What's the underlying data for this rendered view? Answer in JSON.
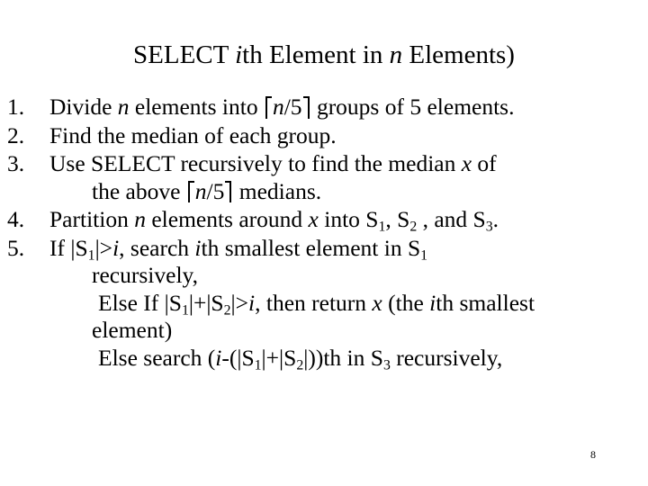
{
  "slide": {
    "background_color": "#ffffff",
    "text_color": "#000000",
    "page_number": "8",
    "title": {
      "full_text": "SELECT ith Element in n Elements)",
      "part1": "SELECT ",
      "var_i": "i",
      "part2": "th Element in ",
      "var_n": "n",
      "part3": " Elements)"
    },
    "steps": [
      {
        "marker": "1.",
        "full_text": "Divide n elements into ⌈n/5⌉ groups of 5 elements.",
        "lines": [
          {
            "segments": [
              {
                "t": "Divide ",
                "style": "roman"
              },
              {
                "t": "n",
                "style": "italic"
              },
              {
                "t": " elements into ",
                "style": "roman"
              },
              {
                "t": "⌈",
                "style": "ceil-open"
              },
              {
                "t": "n",
                "style": "italic"
              },
              {
                "t": "/5",
                "style": "roman"
              },
              {
                "t": "⌉",
                "style": "ceil-close"
              },
              {
                "t": " groups of 5 elements.",
                "style": "roman"
              }
            ]
          }
        ]
      },
      {
        "marker": "2.",
        "full_text": "Find the median of each group.",
        "lines": [
          {
            "segments": [
              {
                "t": "Find the median of each group.",
                "style": "roman"
              }
            ]
          }
        ]
      },
      {
        "marker": "3.",
        "full_text": "Use SELECT recursively to find the median x of the above ⌈n/5⌉ medians.",
        "lines": [
          {
            "segments": [
              {
                "t": "Use SELECT recursively to find the median ",
                "style": "roman"
              },
              {
                "t": "x",
                "style": "italic"
              },
              {
                "t": " of",
                "style": "roman"
              }
            ]
          },
          {
            "segments": [
              {
                "t": "the above ",
                "style": "roman"
              },
              {
                "t": "⌈",
                "style": "ceil-open"
              },
              {
                "t": "n",
                "style": "italic"
              },
              {
                "t": "/5",
                "style": "roman"
              },
              {
                "t": "⌉",
                "style": "ceil-close"
              },
              {
                "t": " medians.",
                "style": "roman"
              }
            ]
          }
        ]
      },
      {
        "marker": "4.",
        "full_text": "Partition n elements around x into S1, S2 , and S3.",
        "lines": [
          {
            "segments": [
              {
                "t": "Partition ",
                "style": "roman"
              },
              {
                "t": "n",
                "style": "italic"
              },
              {
                "t": " elements around ",
                "style": "roman"
              },
              {
                "t": "x",
                "style": "italic"
              },
              {
                "t": " into S",
                "style": "roman"
              },
              {
                "t": "1",
                "style": "sub"
              },
              {
                "t": ", S",
                "style": "roman"
              },
              {
                "t": "2",
                "style": "sub"
              },
              {
                "t": " , and S",
                "style": "roman"
              },
              {
                "t": "3",
                "style": "sub"
              },
              {
                "t": ".",
                "style": "roman"
              }
            ]
          }
        ]
      },
      {
        "marker": "5.",
        "full_text": "If |S1|>i, search ith smallest element in S1 recursively, Else If |S1|+|S2|>i, then return x (the ith smallest element) Else search (i-(|S1|+|S2|))th in S3 recursively,",
        "lines": [
          {
            "segments": [
              {
                "t": "If |S",
                "style": "roman"
              },
              {
                "t": "1",
                "style": "sub"
              },
              {
                "t": "|>",
                "style": "roman"
              },
              {
                "t": "i",
                "style": "italic"
              },
              {
                "t": ", search ",
                "style": "roman"
              },
              {
                "t": "i",
                "style": "italic"
              },
              {
                "t": "th smallest element in S",
                "style": "roman"
              },
              {
                "t": "1",
                "style": "sub"
              }
            ]
          },
          {
            "segments": [
              {
                "t": "recursively,",
                "style": "roman"
              }
            ]
          },
          {
            "indent": "else",
            "segments": [
              {
                "t": " Else If |S",
                "style": "roman"
              },
              {
                "t": "1",
                "style": "sub"
              },
              {
                "t": "|+|S",
                "style": "roman"
              },
              {
                "t": "2",
                "style": "sub"
              },
              {
                "t": "|>",
                "style": "roman"
              },
              {
                "t": "i",
                "style": "italic"
              },
              {
                "t": ", then return ",
                "style": "roman"
              },
              {
                "t": "x",
                "style": "italic"
              },
              {
                "t": " (the ",
                "style": "roman"
              },
              {
                "t": "i",
                "style": "italic"
              },
              {
                "t": "th smallest",
                "style": "roman"
              }
            ]
          },
          {
            "segments": [
              {
                "t": "element)",
                "style": "roman"
              }
            ]
          },
          {
            "indent": "else",
            "segments": [
              {
                "t": " Else search (",
                "style": "roman"
              },
              {
                "t": "i",
                "style": "italic"
              },
              {
                "t": "-(|S",
                "style": "roman"
              },
              {
                "t": "1",
                "style": "sub"
              },
              {
                "t": "|+|S",
                "style": "roman"
              },
              {
                "t": "2",
                "style": "sub"
              },
              {
                "t": "|))th in S",
                "style": "roman"
              },
              {
                "t": "3",
                "style": "sub"
              },
              {
                "t": " recursively,",
                "style": "roman"
              }
            ]
          }
        ]
      }
    ]
  }
}
